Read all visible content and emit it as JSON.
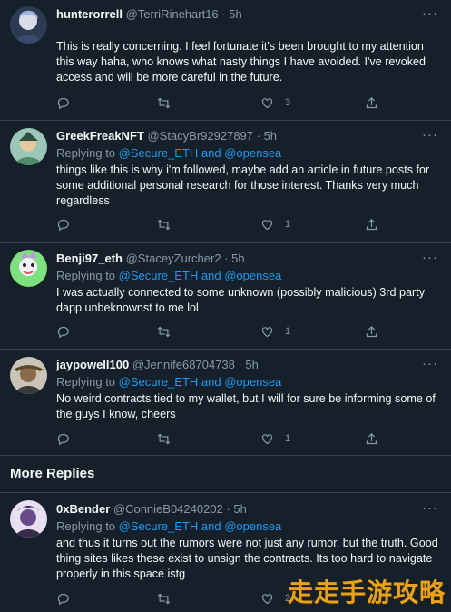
{
  "tweets": [
    {
      "name": "hunterorrell",
      "handle": "@TerriRinehart16",
      "time": "· 5h",
      "replying_prefix": "",
      "replying_to": "",
      "text": "This is really concerning. I feel fortunate it's been brought to my attention this way haha, who knows what nasty things I have avoided. I've revoked access and will be more careful in the future.",
      "like_count": "3",
      "avatar_color": "#5b6f8a"
    },
    {
      "name": "GreekFreakNFT",
      "handle": "@StacyBr92927897",
      "time": "· 5h",
      "replying_prefix": "Replying to",
      "replying_to": "@Secure_ETH and @opensea",
      "text": "things like this is why i'm followed, maybe add an article in future posts for some additional personal research for those interest. Thanks very much regardless",
      "like_count": "1",
      "avatar_color": "#9cc6b8"
    },
    {
      "name": "Benji97_eth",
      "handle": "@StaceyZurcher2",
      "time": "· 5h",
      "replying_prefix": "Replying to",
      "replying_to": "@Secure_ETH and @opensea",
      "text": "I was actually connected to some unknown (possibly malicious) 3rd party dapp unbeknownst to me lol",
      "like_count": "1",
      "avatar_color": "#7fe07f"
    },
    {
      "name": "jaypowell100",
      "handle": "@Jennife68704738",
      "time": "· 5h",
      "replying_prefix": "Replying to",
      "replying_to": "@Secure_ETH and @opensea",
      "text": "No weird contracts tied to my wallet, but I will for sure be informing some of the guys I know, cheers",
      "like_count": "1",
      "avatar_color": "#c9c3b8"
    },
    {
      "name": "0xBender",
      "handle": "@ConnieB04240202",
      "time": "· 5h",
      "replying_prefix": "Replying to",
      "replying_to": "@Secure_ETH and @opensea",
      "text": "and thus it turns out the rumors were not just any rumor, but the truth. Good thing sites likes these exist to unsign the contracts. Its too hard to navigate properly in this space istg",
      "like_count": "2",
      "avatar_color": "#e8e0f0"
    }
  ],
  "more_replies_label": "More Replies",
  "watermark": "走走手游攻略",
  "colors": {
    "background": "#15202b",
    "text": "#f7f9f9",
    "muted": "#8b98a5",
    "link": "#1d9bf0",
    "divider": "#38444d"
  },
  "icons": {
    "reply": "speech-bubble-icon",
    "retweet": "retweet-icon",
    "like": "heart-icon",
    "share": "share-upload-icon",
    "more": "more-dots-icon"
  }
}
